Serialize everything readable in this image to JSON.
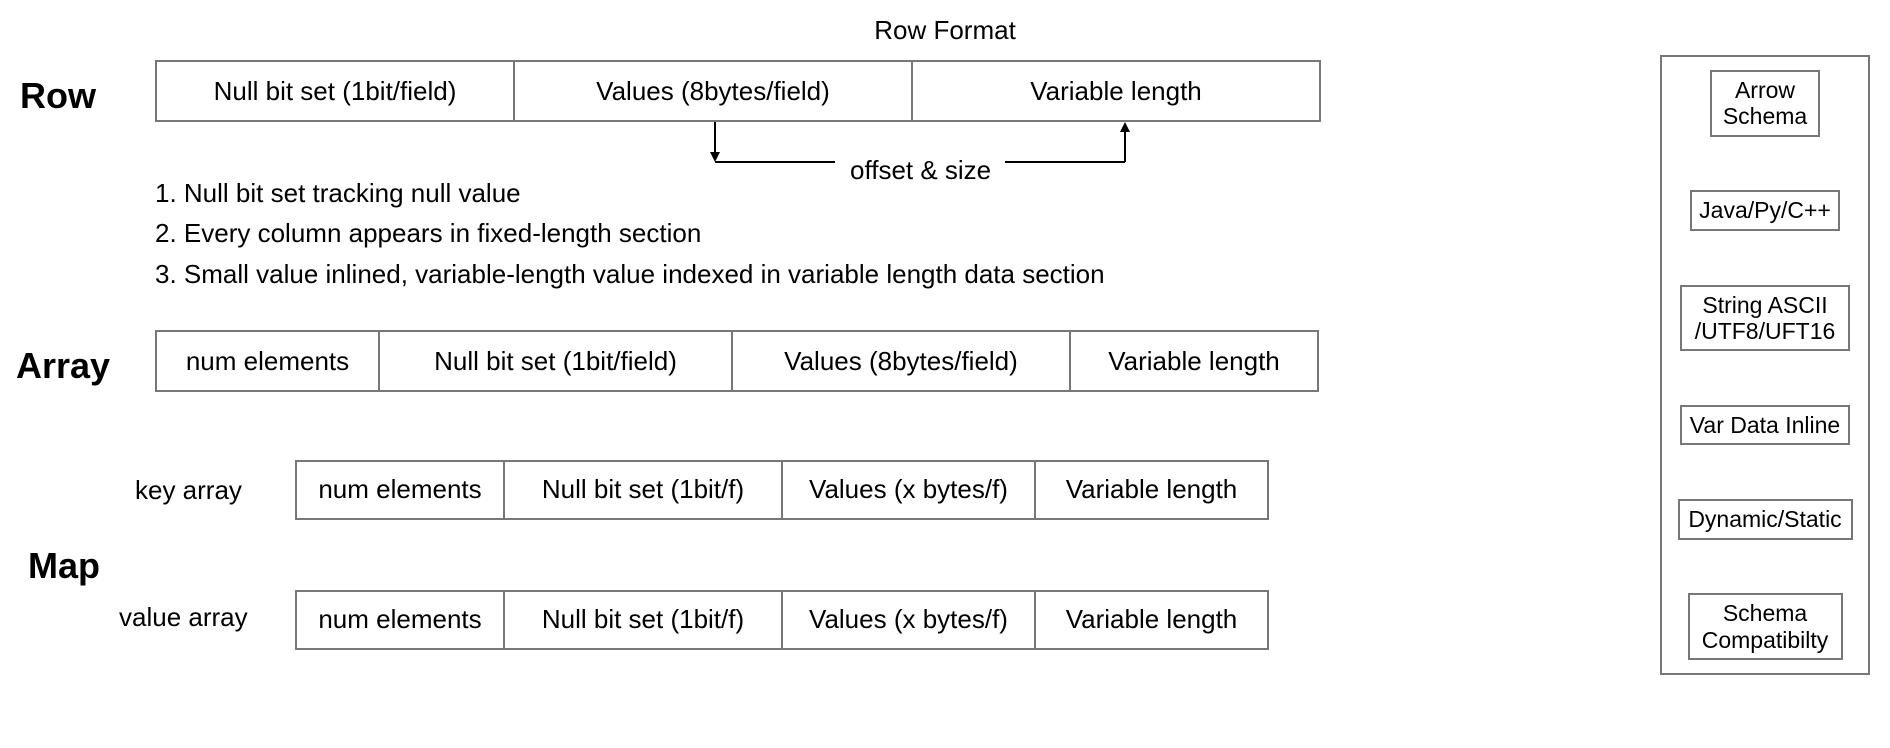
{
  "title": "Row Format",
  "labels": {
    "row": "Row",
    "array": "Array",
    "map": "Map",
    "keyArray": "key array",
    "valueArray": "value array"
  },
  "rowCells": {
    "c1": "Null bit set (1bit/field)",
    "c2": "Values (8bytes/field)",
    "c3": "Variable length"
  },
  "offsetLabel": "offset & size",
  "notes": {
    "n1": "1. Null bit set tracking  null value",
    "n2": "2. Every column appears in fixed-length section",
    "n3": "3. Small value inlined, variable-length value indexed in variable length data section"
  },
  "arrayCells": {
    "c1": "num elements",
    "c2": "Null bit set (1bit/field)",
    "c3": "Values (8bytes/field)",
    "c4": "Variable length"
  },
  "keyCells": {
    "c1": "num elements",
    "c2": "Null bit set (1bit/f)",
    "c3": "Values (x bytes/f)",
    "c4": "Variable length"
  },
  "valueCells": {
    "c1": "num elements",
    "c2": "Null bit set (1bit/f)",
    "c3": "Values (x bytes/f)",
    "c4": "Variable length"
  },
  "sidebar": {
    "b1": "Arrow Schema",
    "b2": "Java/Py/C++",
    "b3": "String ASCII /UTF8/UFT16",
    "b4": "Var Data Inline",
    "b5": "Dynamic/Static",
    "b6": "Schema Compatibilty"
  }
}
